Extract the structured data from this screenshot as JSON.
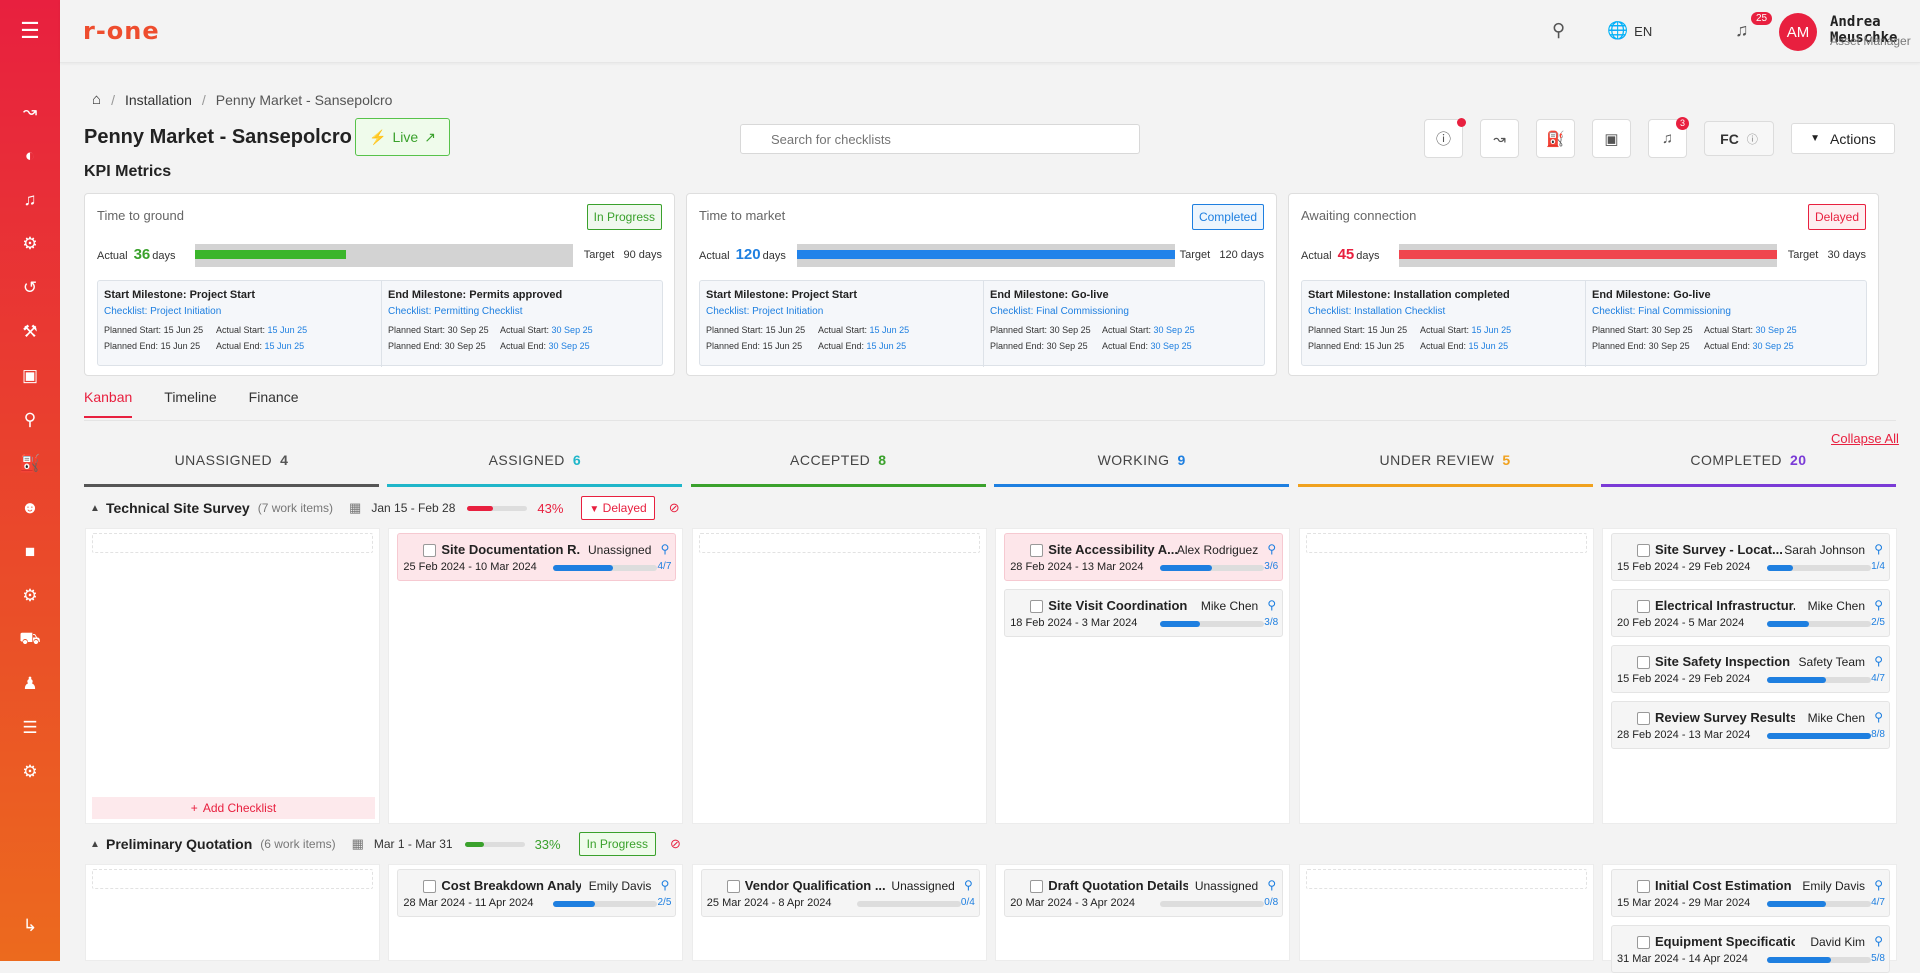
{
  "app": {
    "logo_main": "r-one",
    "logo_accent": ""
  },
  "topbar": {
    "language": "EN",
    "notification_count": "25",
    "user_initials": "AM",
    "user_name": "Andrea Meuschke",
    "user_role": "Asset Manager"
  },
  "breadcrumb": {
    "home_icon": "home-icon",
    "section": "Installation",
    "current": "Penny Market - Sansepolcro"
  },
  "page": {
    "title": "Penny Market - Sansepolcro",
    "status_label": "Live",
    "search_placeholder": "Search for checklists",
    "alerts_badge": "3",
    "fc_label": "FC",
    "actions_label": "Actions",
    "kpi_title": "KPI Metrics"
  },
  "kpis": [
    {
      "name": "Time to ground",
      "status": "In Progress",
      "status_color": "#3aa12c",
      "actual_label": "Actual",
      "actual_value": "36",
      "unit": "days",
      "actual_color": "#3aa12c",
      "target_label": "Target",
      "target": "90 days",
      "progress_fraction": 0.4,
      "bar_color": "#3bb52b",
      "start": {
        "title": "Start Milestone: Project Start",
        "checklist": "Checklist: Project Initiation",
        "planned_start": "15 Jun 25",
        "actual_start": "15 Jun 25",
        "planned_end": "15 Jun 25",
        "actual_end": "15 Jun 25"
      },
      "end": {
        "title": "End Milestone: Permits approved",
        "checklist": "Checklist: Permitting Checklist",
        "planned_start": "30 Sep 25",
        "actual_start": "30 Sep 25",
        "planned_end": "30 Sep 25",
        "actual_end": "30 Sep 25"
      }
    },
    {
      "name": "Time to market",
      "status": "Completed",
      "status_color": "#1e7fe0",
      "actual_label": "Actual",
      "actual_value": "120",
      "unit": "days",
      "actual_color": "#1e7fe0",
      "target_label": "Target",
      "target": "120 days",
      "progress_fraction": 1.0,
      "bar_color": "#2283ea",
      "start": {
        "title": "Start Milestone: Project Start",
        "checklist": "Checklist: Project Initiation",
        "planned_start": "15 Jun 25",
        "actual_start": "15 Jun 25",
        "planned_end": "15 Jun 25",
        "actual_end": "15 Jun 25"
      },
      "end": {
        "title": "End Milestone: Go-live",
        "checklist": "Checklist: Final Commissioning",
        "planned_start": "30 Sep 25",
        "actual_start": "30 Sep 25",
        "planned_end": "30 Sep 25",
        "actual_end": "30 Sep 25"
      }
    },
    {
      "name": "Awaiting connection",
      "status": "Delayed",
      "status_color": "#e8203f",
      "actual_label": "Actual",
      "actual_value": "45",
      "unit": "days",
      "actual_color": "#e8203f",
      "target_label": "Target",
      "target": "30 days",
      "progress_fraction": 1.0,
      "bar_color": "#f0454e",
      "start": {
        "title": "Start Milestone: Installation completed",
        "checklist": "Checklist: Installation Checklist",
        "planned_start": "15 Jun 25",
        "actual_start": "15 Jun 25",
        "planned_end": "15 Jun 25",
        "actual_end": "15 Jun 25"
      },
      "end": {
        "title": "End Milestone: Go-live",
        "checklist": "Checklist: Final Commissioning",
        "planned_start": "30 Sep 25",
        "actual_start": "30 Sep 25",
        "planned_end": "30 Sep 25",
        "actual_end": "30 Sep 25"
      }
    }
  ],
  "labels": {
    "planned_start": "Planned Start:",
    "actual_start": "Actual Start:",
    "planned_end": "Planned End:",
    "actual_end": "Actual End:"
  },
  "tabs": [
    "Kanban",
    "Timeline",
    "Finance"
  ],
  "kanban": {
    "collapse_all": "Collapse All",
    "add_checklist": "Add Checklist",
    "columns": [
      {
        "name": "UNASSIGNED",
        "count": "4",
        "color": "#555555"
      },
      {
        "name": "ASSIGNED",
        "count": "6",
        "color": "#1fb6c9"
      },
      {
        "name": "ACCEPTED",
        "count": "8",
        "color": "#3aa12c"
      },
      {
        "name": "WORKING",
        "count": "9",
        "color": "#1e7fe0"
      },
      {
        "name": "UNDER REVIEW",
        "count": "5",
        "color": "#f0a11e"
      },
      {
        "name": "COMPLETED",
        "count": "20",
        "color": "#7a3ad6"
      }
    ],
    "groups": [
      {
        "name": "Technical Site Survey",
        "items": "(7 work items)",
        "dates": "Jan 15 - Feb 28",
        "percent": "43%",
        "progress": 0.43,
        "color": "#e8203f",
        "status": "Delayed",
        "cards": [
          [],
          [
            {
              "title": "Site Documentation R...",
              "who": "Unassigned",
              "dates": "25 Feb 2024 - 10 Mar 2024",
              "prog": "4/7",
              "frac": 0.57,
              "red": true
            }
          ],
          [],
          [
            {
              "title": "Site Accessibility A...",
              "who": "Alex Rodriguez",
              "dates": "28 Feb 2024 - 13 Mar 2024",
              "prog": "3/6",
              "frac": 0.5,
              "red": true
            },
            {
              "title": "Site Visit Coordination",
              "who": "Mike Chen",
              "dates": "18 Feb 2024 - 3 Mar 2024",
              "prog": "3/8",
              "frac": 0.38,
              "red": false
            }
          ],
          [],
          [
            {
              "title": "Site Survey - Locat...",
              "who": "Sarah Johnson",
              "dates": "15 Feb 2024 - 29 Feb 2024",
              "prog": "1/4",
              "frac": 0.25,
              "red": false
            },
            {
              "title": "Electrical Infrastructur...",
              "who": "Mike Chen",
              "dates": "20 Feb 2024 - 5 Mar 2024",
              "prog": "2/5",
              "frac": 0.4,
              "red": false
            },
            {
              "title": "Site Safety Inspection",
              "who": "Safety Team",
              "dates": "15 Feb 2024 - 29 Feb 2024",
              "prog": "4/7",
              "frac": 0.57,
              "red": false
            },
            {
              "title": "Review Survey Results",
              "who": "Mike Chen",
              "dates": "28 Feb 2024 - 13 Mar 2024",
              "prog": "8/8",
              "frac": 1.0,
              "red": false
            }
          ]
        ]
      },
      {
        "name": "Preliminary Quotation",
        "items": "(6 work items)",
        "dates": "Mar 1 - Mar 31",
        "percent": "33%",
        "progress": 0.33,
        "color": "#3aa12c",
        "status": "In Progress",
        "cards": [
          [],
          [
            {
              "title": "Cost Breakdown Analy...",
              "who": "Emily Davis",
              "dates": "28 Mar 2024 - 11 Apr 2024",
              "prog": "2/5",
              "frac": 0.4,
              "red": false
            }
          ],
          [
            {
              "title": "Vendor Qualification ...",
              "who": "Unassigned",
              "dates": "25 Mar 2024 - 8 Apr 2024",
              "prog": "0/4",
              "frac": 0,
              "red": false
            }
          ],
          [
            {
              "title": "Draft Quotation Details",
              "who": "Unassigned",
              "dates": "20 Mar 2024 - 3 Apr 2024",
              "prog": "0/8",
              "frac": 0,
              "red": false
            }
          ],
          [],
          [
            {
              "title": "Initial Cost Estimation",
              "who": "Emily Davis",
              "dates": "15 Mar 2024 - 29 Mar 2024",
              "prog": "4/7",
              "frac": 0.57,
              "red": false
            },
            {
              "title": "Equipment Specificatio...",
              "who": "David Kim",
              "dates": "31 Mar 2024 - 14 Apr 2024",
              "prog": "5/8",
              "frac": 0.62,
              "red": false
            }
          ]
        ]
      }
    ]
  }
}
